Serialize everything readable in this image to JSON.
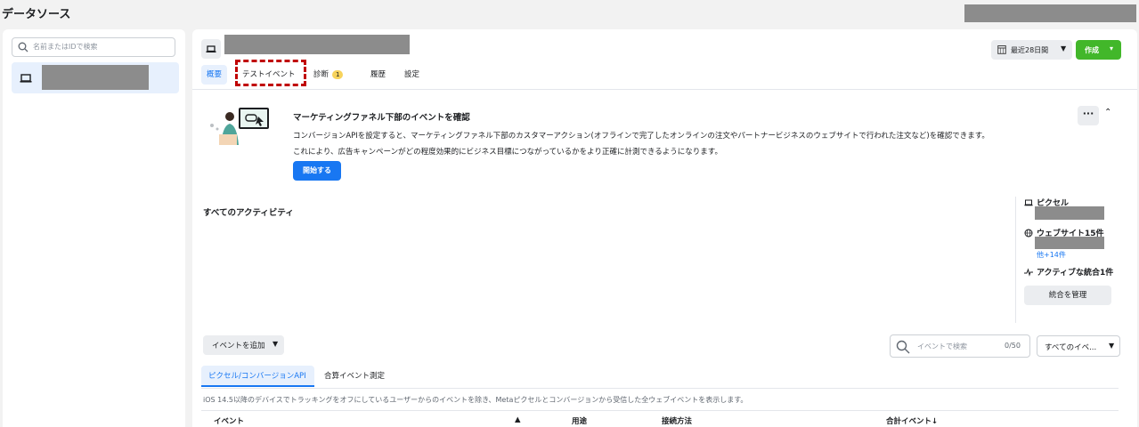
{
  "page": {
    "title": "データソース"
  },
  "sidebar": {
    "search_placeholder": "名前またはIDで検索"
  },
  "header": {
    "tabs": [
      {
        "label": "概要",
        "active": true
      },
      {
        "label": "テストイベント",
        "active": false
      },
      {
        "label": "診断",
        "badge": "1",
        "active": false
      },
      {
        "label": "履歴",
        "active": false
      },
      {
        "label": "設定",
        "active": false
      }
    ],
    "date_range_label": "最近28日間",
    "create_label": "作成"
  },
  "promo": {
    "title": "マーケティングファネル下部のイベントを確認",
    "text1": "コンバージョンAPIを設定すると、マーケティングファネル下部のカスタマーアクション(オフラインで完了したオンラインの注文やパートナービジネスのウェブサイトで行われた注文など)を確認できます。",
    "text2": "これにより、広告キャンペーンがどの程度効果的にビジネス目標につながっているかをより正確に計測できるようになります。",
    "start_label": "開始する",
    "more_label": "···"
  },
  "activity": {
    "title": "すべてのアクティビティ"
  },
  "right_panel": {
    "pixel_label": "ピクセル",
    "websites_label": "ウェブサイト15件",
    "more_link": "他+14件",
    "integrations_label": "アクティブな統合1件",
    "manage_label": "統合を管理"
  },
  "events": {
    "add_label": "イベントを追加",
    "search_placeholder": "イベントで検索",
    "search_count": "0/50",
    "filter_label": "すべてのイベ...",
    "subtabs": [
      "ピクセル/コンバージョンAPI",
      "合算イベント測定"
    ],
    "notice": "iOS 14.5以降のデバイスでトラッキングをオフにしているユーザーからのイベントを除き、Metaピクセルとコンバージョンから受信した全ウェブイベントを表示します。",
    "columns": [
      "イベント",
      "▲",
      "用途",
      "接続方法",
      "合計イベント↓"
    ]
  },
  "colors": {
    "accent": "#1877f2",
    "create": "#42b72a",
    "highlight": "#c00000"
  }
}
